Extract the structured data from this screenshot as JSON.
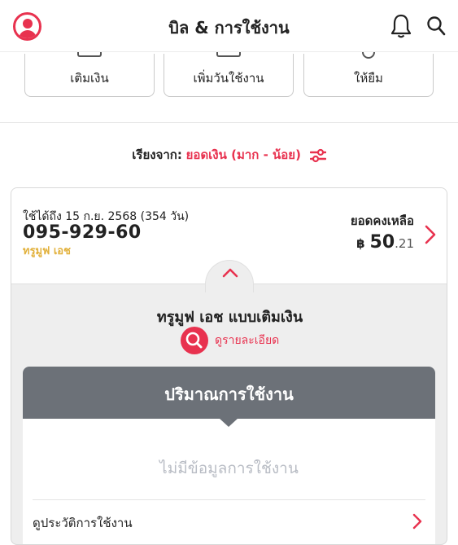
{
  "header": {
    "title": "บิล & การใช้งาน",
    "icons": [
      "profile-avatar-icon",
      "bell-icon",
      "search-icon"
    ]
  },
  "actions": [
    {
      "label": "เติมเงิน"
    },
    {
      "label": "เพิ่มวันใช้งาน"
    },
    {
      "label": "ให้ยืม"
    }
  ],
  "sort": {
    "label": "เรียงจาก:",
    "value": "ยอดเงิน (มาก - น้อย)"
  },
  "card": {
    "valid_until": "ใช้ได้ถึง 15 ก.ย. 2568 (354 วัน)",
    "phone": "095-929-60",
    "plan_short": "ทรูมูฟ เอช",
    "balance_label": "ยอดคงเหลือ",
    "currency": "฿",
    "balance_int": "50",
    "balance_dec": ".21",
    "plan_name": "ทรูมูฟ เอช แบบเติมเงิน",
    "detail_label": "ดูรายละเอียด"
  },
  "usage": {
    "title": "ปริมาณการใช้งาน",
    "empty": "ไม่มีข้อมูลการใช้งาน",
    "history": "ดูประวัติการใช้งาน"
  },
  "colors": {
    "accent": "#e8324f",
    "plan_gold": "#e2b13c",
    "usage_header": "#6c7178"
  }
}
